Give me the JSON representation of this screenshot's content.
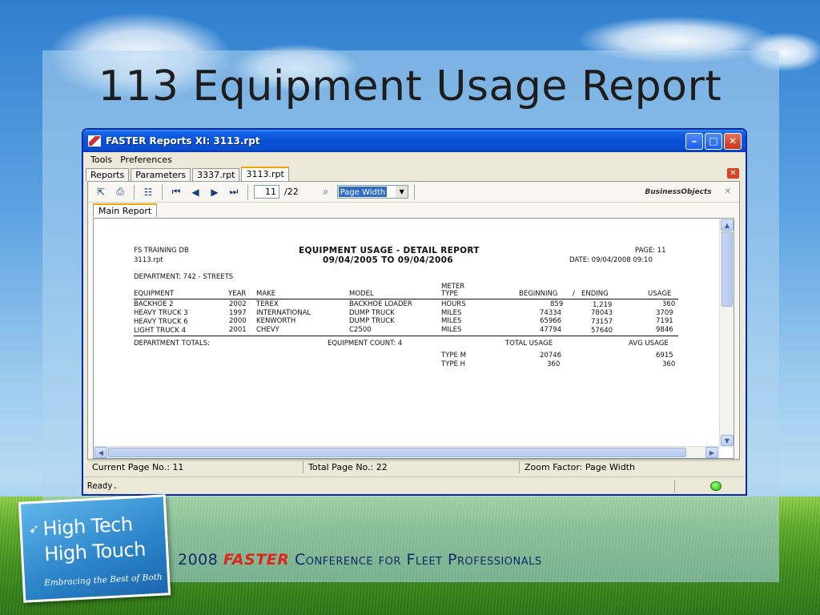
{
  "slide": {
    "title": "113 Equipment Usage Report",
    "conference_year": "2008",
    "conference_brand": "FASTER",
    "conference_rest": "Conference for Fleet Professionals",
    "badge": {
      "line1": "High Tech",
      "line2": "High Touch",
      "tagline": "Embracing the Best of Both"
    }
  },
  "window": {
    "title": "FASTER Reports XI: 3113.rpt",
    "menu": [
      "Tools",
      "Preferences"
    ],
    "tabs": [
      "Reports",
      "Parameters",
      "3337.rpt",
      "3113.rpt"
    ],
    "active_tab": "3113.rpt",
    "toolbar": {
      "current_page": "11",
      "total_pages": "/22",
      "zoom": "Page Width",
      "logo": "BusinessObjects"
    },
    "subtab": "Main Report",
    "status": {
      "current_page": "Current Page No.: 11",
      "total_page": "Total Page No.: 22",
      "zoom": "Zoom Factor: Page Width",
      "ready": "Ready."
    }
  },
  "report": {
    "db": "FS TRAINING DB",
    "file": "3113.rpt",
    "title": "EQUIPMENT USAGE - DETAIL REPORT",
    "date_range": "09/04/2005 TO 09/04/2006",
    "page": "PAGE: 11",
    "date": "DATE: 09/04/2008 09:10",
    "department": "DEPARTMENT: 742 - STREETS",
    "headers": {
      "equipment": "EQUIPMENT",
      "year": "YEAR",
      "make": "MAKE",
      "model": "MODEL",
      "meter_line1": "METER",
      "meter_line2": "TYPE",
      "beginning": "BEGINNING",
      "slash": "/",
      "ending": "ENDING",
      "usage": "USAGE"
    },
    "rows": [
      {
        "equipment": "BACKHOE 2",
        "year": "2002",
        "make": "TEREX",
        "model": "BACKHOE LOADER",
        "meter": "HOURS",
        "beginning": "859",
        "ending": "1,219",
        "usage": "360"
      },
      {
        "equipment": "HEAVY TRUCK 3",
        "year": "1997",
        "make": "INTERNATIONAL",
        "model": "DUMP TRUCK",
        "meter": "MILES",
        "beginning": "74334",
        "ending": "78043",
        "usage": "3709"
      },
      {
        "equipment": "HEAVY TRUCK 6",
        "year": "2000",
        "make": "KENWORTH",
        "model": "DUMP TRUCK",
        "meter": "MILES",
        "beginning": "65966",
        "ending": "73157",
        "usage": "7191"
      },
      {
        "equipment": "LIGHT TRUCK 4",
        "year": "2001",
        "make": "CHEVY",
        "model": "C2500",
        "meter": "MILES",
        "beginning": "47794",
        "ending": "57640",
        "usage": "9846"
      }
    ],
    "totals": {
      "label": "DEPARTMENT TOTALS:",
      "equipment_count": "EQUIPMENT COUNT:  4",
      "total_usage": "TOTAL USAGE",
      "avg_usage": "AVG USAGE",
      "type_m_label": "TYPE M",
      "type_m_total": "20746",
      "type_m_avg": "6915",
      "type_h_label": "TYPE H",
      "type_h_total": "360",
      "type_h_avg": "360"
    }
  }
}
